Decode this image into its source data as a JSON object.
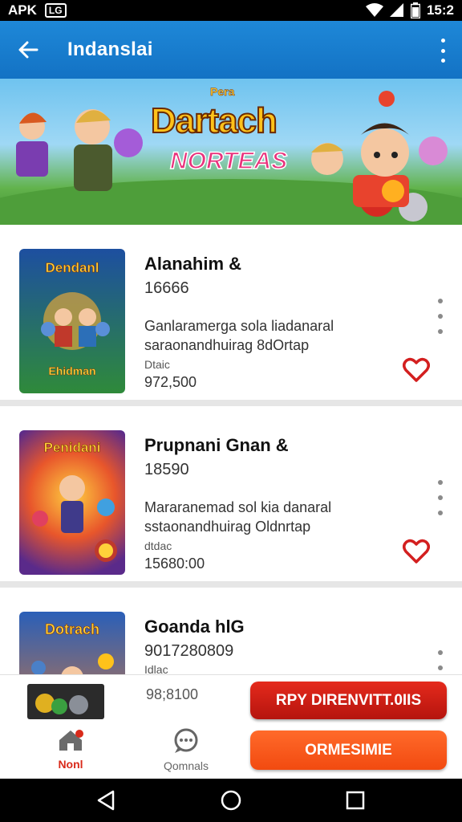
{
  "status_bar": {
    "carrier": "APK",
    "icon_text": "LG",
    "time": "15:2"
  },
  "app_bar": {
    "title": "Indanslai",
    "back_icon": "arrow-left-icon",
    "more_icon": "more-vertical-icon"
  },
  "banner": {
    "title_top": "Pera",
    "title": "Dartach",
    "subtitle": "NORTEAS"
  },
  "items": [
    {
      "title": "Alanahim &",
      "number": "16666",
      "desc_1": "Ganlaramerga sola liadanaral",
      "desc_2": "saraonandhuirag 8dOrtap",
      "label": "Dtaic",
      "price": "972,500",
      "thumb_text": "Dendanl",
      "thumb_bottom": "Ehidman"
    },
    {
      "title": "Prupnani Gnan &",
      "number": "18590",
      "desc_1": "Mararanemad sol kia danaral",
      "desc_2": "sstaonandhuirag Oldnrtap",
      "label": "dtdac",
      "price": "15680:00",
      "thumb_text": "Penidani",
      "thumb_bottom": ""
    },
    {
      "title": "Goanda hlG",
      "number": "9017280809",
      "desc_1": "",
      "desc_2": "",
      "label": "Idlac",
      "price": "",
      "thumb_text": "Dotrach",
      "thumb_bottom": ""
    }
  ],
  "bottom": {
    "price": "98;8100",
    "primary_button": "RPY DIRENVITT.0IIS",
    "secondary_button": "ORMESIMIE",
    "nav_home": "Nonl",
    "nav_chat": "Qomnals"
  },
  "colors": {
    "app_bar": "#1e88d8",
    "accent_red": "#d92a1a",
    "accent_orange": "#f24a10"
  }
}
